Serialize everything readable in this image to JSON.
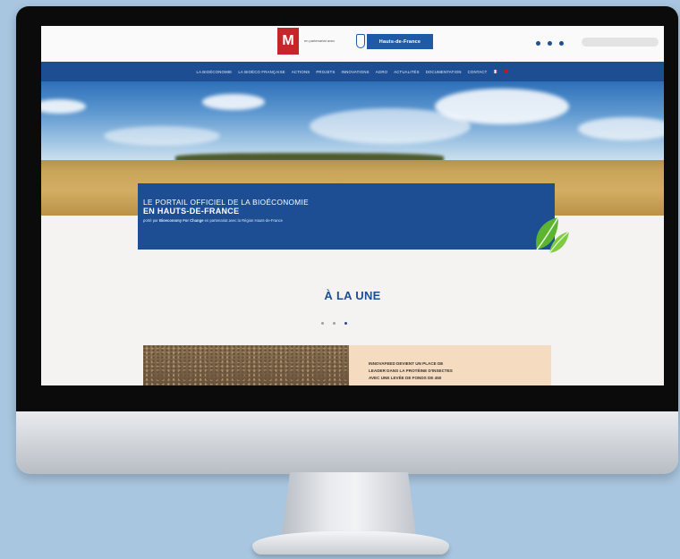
{
  "site": {
    "logo_text": "M",
    "partner_text": "en partenariat avec",
    "region_badge": "Hauts-de-France",
    "search": {
      "placeholder": ""
    }
  },
  "nav": {
    "items": [
      {
        "label": "La bioéconomie"
      },
      {
        "label": "La bioéco française"
      },
      {
        "label": "Actions"
      },
      {
        "label": "Projets"
      },
      {
        "label": "Innovations"
      },
      {
        "label": "Agro"
      },
      {
        "label": "Actualités"
      },
      {
        "label": "Documentation"
      },
      {
        "label": "Contact"
      }
    ]
  },
  "hero": {
    "title": "LE PORTAIL OFFICIEL DE LA BIOÉCONOMIE",
    "subtitle": "EN HAUTS-DE-FRANCE",
    "tagline_prefix": "porté par",
    "tagline_brand": "Bioeconomy For Change",
    "tagline_suffix": "en partenariat avec la Région Hauts-de-France"
  },
  "featured": {
    "section_title": "À LA UNE",
    "carousel_count": 3,
    "carousel_active_index": 2,
    "card_headline_lines": [
      "Innovafeed devient un place de",
      "leader dans la protéine d'insectes",
      "avec une levée de fonds de 450"
    ]
  },
  "colors": {
    "brand_blue": "#1d4e94",
    "logo_red": "#c4262b",
    "card_peach": "#f5dcc0",
    "leaf_green": "#5cb531"
  },
  "icons": [
    "logo-icon",
    "region-emblem-icon",
    "social-icon",
    "flag-fr-icon",
    "flag-en-icon",
    "leaf-icon"
  ]
}
